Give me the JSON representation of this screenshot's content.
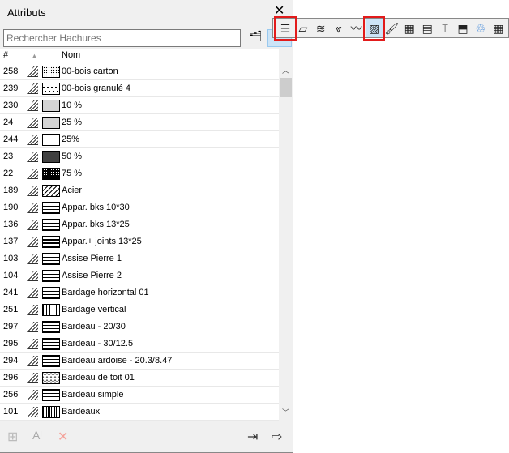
{
  "panel": {
    "title": "Attributs",
    "search_placeholder": "Rechercher Hachures"
  },
  "columns": {
    "num": "#",
    "sort": "▲",
    "name": "Nom"
  },
  "rows": [
    {
      "num": "258",
      "name": "00-bois carton",
      "pat": "dots"
    },
    {
      "num": "239",
      "name": "00-bois granulé 4",
      "pat": "sparse"
    },
    {
      "num": "230",
      "name": "10 %",
      "pat": "fine"
    },
    {
      "num": "24",
      "name": "25 %",
      "pat": "fine"
    },
    {
      "num": "244",
      "name": "25%",
      "pat": "empty"
    },
    {
      "num": "23",
      "name": "50 %",
      "pat": "mid"
    },
    {
      "num": "22",
      "name": "75 %",
      "pat": "dark"
    },
    {
      "num": "189",
      "name": "Acier",
      "pat": "diag"
    },
    {
      "num": "190",
      "name": "Appar. bks 10*30",
      "pat": "brick"
    },
    {
      "num": "136",
      "name": "Appar. bks 13*25",
      "pat": "brick"
    },
    {
      "num": "137",
      "name": "Appar.+ joints 13*25",
      "pat": "brickdark"
    },
    {
      "num": "103",
      "name": "Assise Pierre 1",
      "pat": "brick"
    },
    {
      "num": "104",
      "name": "Assise Pierre 2",
      "pat": "brick"
    },
    {
      "num": "241",
      "name": "Bardage horizontal 01",
      "pat": "hlines"
    },
    {
      "num": "251",
      "name": "Bardage vertical",
      "pat": "vlines"
    },
    {
      "num": "297",
      "name": "Bardeau - 20/30",
      "pat": "brick"
    },
    {
      "num": "295",
      "name": "Bardeau - 30/12.5",
      "pat": "brick"
    },
    {
      "num": "294",
      "name": "Bardeau ardoise - 20.3/8.47",
      "pat": "brick"
    },
    {
      "num": "296",
      "name": "Bardeau de toit 01",
      "pat": "scale"
    },
    {
      "num": "256",
      "name": "Bardeau simple",
      "pat": "brick"
    },
    {
      "num": "101",
      "name": "Bardeaux",
      "pat": "vdark"
    },
    {
      "num": "",
      "name": "",
      "pat": "dark"
    }
  ],
  "toolbar": [
    "list",
    "surface",
    "composite",
    "pen",
    "line",
    "fill",
    "brush",
    "building-material",
    "profile-stack",
    "profile",
    "zone",
    "mep",
    "grid"
  ]
}
